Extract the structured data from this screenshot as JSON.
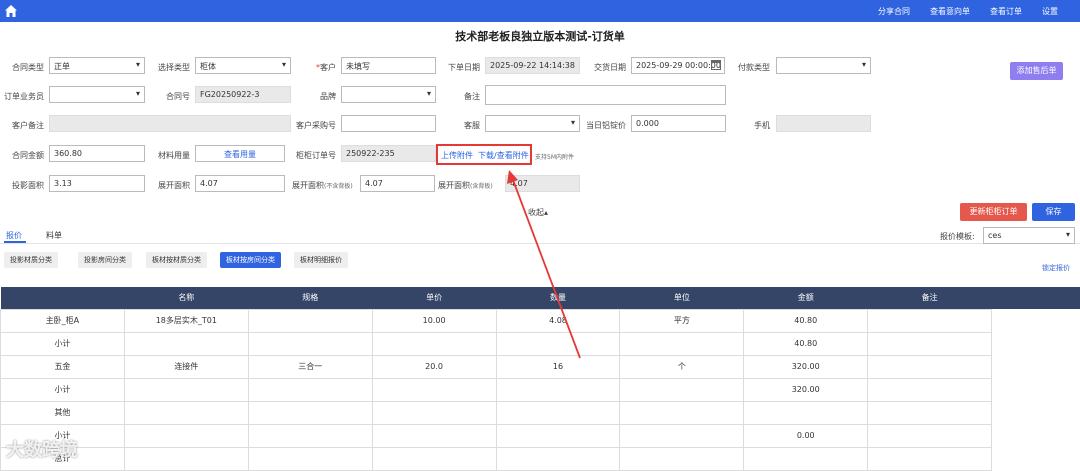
{
  "header": {
    "nav": [
      "分享合同",
      "查看意向单",
      "查看订单",
      "设置"
    ]
  },
  "page_title": "技术部老板良独立版本测试-订货单",
  "form": {
    "contract_type_label": "合同类型",
    "contract_type_value": "正单",
    "select_type_label": "选择类型",
    "select_type_value": "柜体",
    "customer_label": "客户",
    "customer_value": "未填写",
    "order_date_label": "下单日期",
    "order_date_value": "2025-09-22 14:14:38",
    "delivery_date_label": "交货日期",
    "delivery_date_value": "2025-09-29 00:00:00",
    "payment_type_label": "付款类型",
    "salesperson_label": "订单业务员",
    "contract_no_label": "合同号",
    "contract_no_value": "FG20250922-3",
    "brand_label": "品牌",
    "remark_label": "备注",
    "customer_remark_label": "客户备注",
    "customer_purchase_no_label": "客户采购号",
    "service_label": "客服",
    "daily_price_label": "当日铝锭价",
    "daily_price_value": "0.000",
    "phone_label": "手机",
    "contract_amount_label": "合同金额",
    "contract_amount_value": "360.80",
    "material_usage_label": "材料用量",
    "view_usage_label": "查看用量",
    "cabinet_order_label": "柜柜订单号",
    "cabinet_order_value": "250922-235",
    "upload_attachment": "上传附件",
    "download_attachment": "下载/查看附件",
    "attachment_hint": "支持5M内附件",
    "projection_area_label": "投影面积",
    "projection_area_value": "3.13",
    "unfold_area_label": "展开面积",
    "unfold_area_value": "4.07",
    "unfold_area2_label": "展开面积",
    "unfold_area2_note": "(不含背板)",
    "unfold_area2_value": "4.07",
    "unfold_area3_label": "展开面积",
    "unfold_area3_note": "(含背板)",
    "unfold_area3_value": "4.07",
    "collapse": "收起▴"
  },
  "buttons": {
    "add_after_sale": "添加售后单",
    "update_cabinet_order": "更新柜柜订单",
    "save": "保存"
  },
  "tabs": [
    "报价",
    "料单"
  ],
  "quote_template_label": "报价模板:",
  "quote_template_value": "ces",
  "lock_quote": "锁定报价",
  "subtabs": [
    "投影材质分类",
    "投影房间分类",
    "板材按材质分类",
    "板材按房间分类",
    "板材明细报价"
  ],
  "table": {
    "columns": [
      "",
      "名称",
      "规格",
      "单价",
      "数量",
      "单位",
      "金额",
      "备注"
    ],
    "rows": [
      [
        "主卧_柜A",
        "18多层实木_T01",
        "",
        "10.00",
        "4.08",
        "平方",
        "40.80",
        ""
      ],
      [
        "小计",
        "",
        "",
        "",
        "",
        "",
        "40.80",
        ""
      ],
      [
        "五金",
        "连接件",
        "三合一",
        "20.0",
        "16",
        "个",
        "320.00",
        ""
      ],
      [
        "小计",
        "",
        "",
        "",
        "",
        "",
        "320.00",
        ""
      ],
      [
        "其他",
        "",
        "",
        "",
        "",
        "",
        "",
        ""
      ],
      [
        "小计",
        "",
        "",
        "",
        "",
        "",
        "0.00",
        ""
      ],
      [
        "总计",
        "",
        "",
        "",
        "",
        "",
        "",
        ""
      ]
    ]
  },
  "watermark": "大数跨境",
  "colors": {
    "primary": "#2f63e0",
    "danger": "#e5584b",
    "addbtn": "#8f7ef0",
    "table_header": "#344567"
  }
}
